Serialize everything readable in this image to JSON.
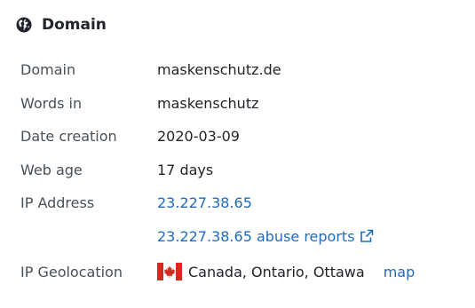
{
  "section": {
    "title": "Domain",
    "icon": "globe-icon"
  },
  "rows": [
    {
      "label": "Domain",
      "value": "maskenschutz.de"
    },
    {
      "label": "Words in",
      "value": "maskenschutz"
    },
    {
      "label": "Date creation",
      "value": "2020-03-09"
    },
    {
      "label": "Web age",
      "value": "17 days"
    },
    {
      "label": "IP Address",
      "value": "23.227.38.65"
    },
    {
      "label": "",
      "value": "23.227.38.65 abuse reports",
      "icon": "external-link-icon"
    },
    {
      "label": "IP Geolocation",
      "value": "Canada, Ontario, Ottawa",
      "flag": "canada-flag-icon",
      "link": "map"
    }
  ],
  "colors": {
    "link": "#1e6bbf",
    "label": "#495057",
    "text": "#212529",
    "flag_red": "#d52b1e"
  }
}
